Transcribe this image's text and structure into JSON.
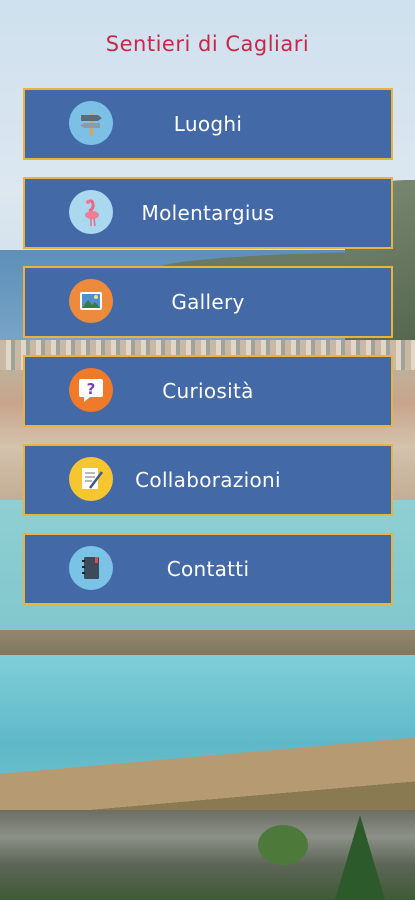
{
  "app": {
    "title": "Sentieri di Cagliari"
  },
  "menu": {
    "items": [
      {
        "label": "Luoghi",
        "icon": "signpost-icon",
        "icon_bg": "#7cc0e6"
      },
      {
        "label": "Molentargius",
        "icon": "flamingo-icon",
        "icon_bg": "#aad8ee"
      },
      {
        "label": "Gallery",
        "icon": "picture-icon",
        "icon_bg": "#ee8a3c"
      },
      {
        "label": "Curiosità",
        "icon": "question-icon",
        "icon_bg": "#ef7a2a"
      },
      {
        "label": "Collaborazioni",
        "icon": "document-pen-icon",
        "icon_bg": "#f6c630"
      },
      {
        "label": "Contatti",
        "icon": "address-book-icon",
        "icon_bg": "#7bc3e6"
      }
    ]
  },
  "colors": {
    "title": "#c8264a",
    "button_bg": "#4369a6",
    "button_border": "#e8b43a",
    "button_text": "#ffffff"
  }
}
